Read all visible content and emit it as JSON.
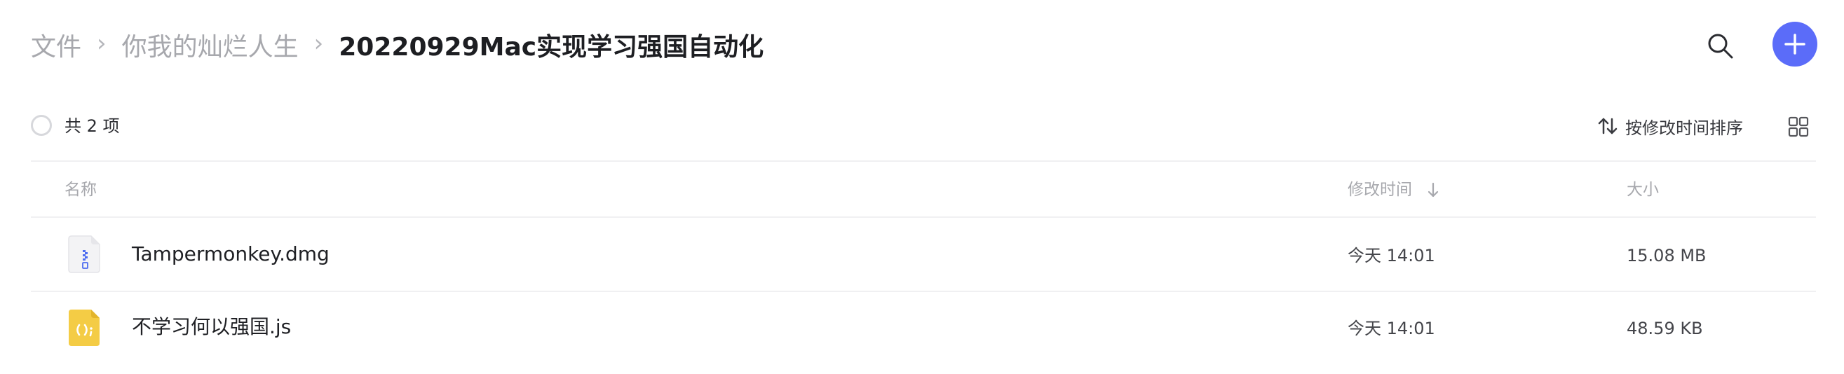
{
  "breadcrumb": {
    "items": [
      "文件",
      "你我的灿烂人生"
    ],
    "separator": "›",
    "current": "20220929Mac实现学习强国自动化"
  },
  "header": {
    "search_icon": "search-icon",
    "add_icon": "plus-icon",
    "accent_color": "#5b6cf9"
  },
  "toolbar": {
    "count_label": "共 2 项",
    "sort_label": "按修改时间排序",
    "sort_icon": "sort-arrows-icon",
    "view_icon": "grid-view-icon"
  },
  "table": {
    "columns": {
      "name": "名称",
      "modified": "修改时间",
      "size": "大小"
    },
    "rows": [
      {
        "icon": "dmg-file-icon",
        "name": "Tampermonkey.dmg",
        "modified": "今天 14:01",
        "size": "15.08 MB"
      },
      {
        "icon": "js-file-icon",
        "name": "不学习何以强国.js",
        "modified": "今天 14:01",
        "size": "48.59 KB"
      }
    ]
  }
}
